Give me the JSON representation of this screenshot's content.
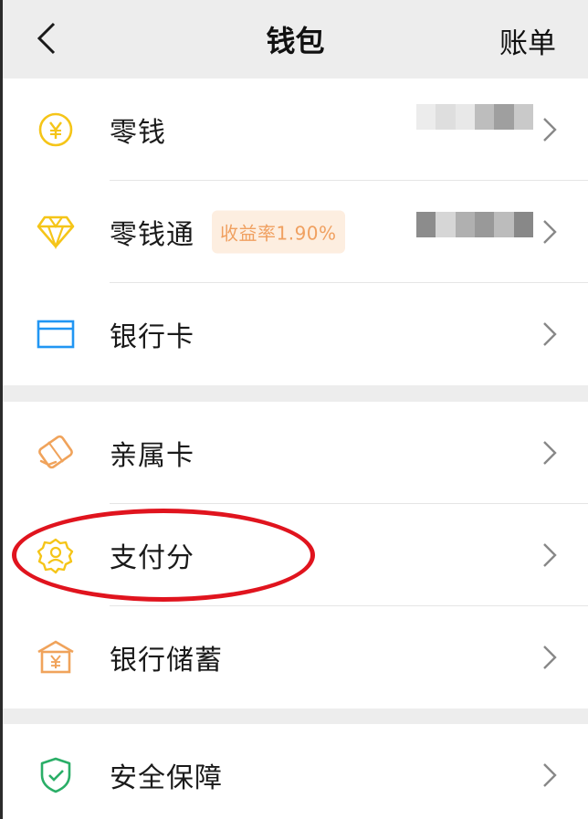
{
  "header": {
    "back_icon": "chevron-left-icon",
    "title": "钱包",
    "bill_label": "账单"
  },
  "groups": [
    {
      "items": [
        {
          "label": "零钱",
          "icon": "yuan-coin-icon",
          "value": ""
        },
        {
          "label": "零钱通",
          "icon": "diamond-icon",
          "badge": "收益率1.90%",
          "value": ""
        },
        {
          "label": "银行卡",
          "icon": "bank-card-icon"
        }
      ]
    },
    {
      "items": [
        {
          "label": "亲属卡",
          "icon": "family-card-icon"
        },
        {
          "label": "支付分",
          "icon": "pay-score-icon"
        },
        {
          "label": "银行储蓄",
          "icon": "bank-savings-icon"
        }
      ]
    },
    {
      "items": [
        {
          "label": "安全保障",
          "icon": "security-shield-icon"
        }
      ]
    }
  ],
  "colors": {
    "accent_yellow": "#f5c518",
    "card_blue": "#2196f3",
    "orange": "#f0a35b",
    "green": "#2aae67",
    "highlight_red": "#e0141e",
    "badge_bg": "#fdeee0",
    "badge_text": "#f0a060"
  }
}
